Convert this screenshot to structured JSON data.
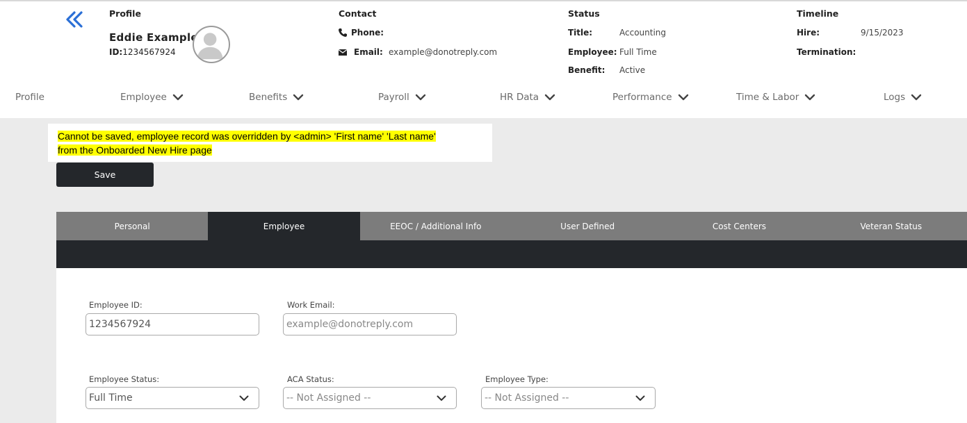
{
  "profile": {
    "heading": "Profile",
    "name": "Eddie Example",
    "id_label": "ID:",
    "id_value": "1234567924"
  },
  "contact": {
    "heading": "Contact",
    "phone_label": "Phone:",
    "phone_value": "",
    "email_label": "Email:",
    "email_value": "example@donotreply.com"
  },
  "status": {
    "heading": "Status",
    "title_label": "Title:",
    "title_value": "Accounting",
    "employee_label": "Employee:",
    "employee_value": "Full Time",
    "benefit_label": "Benefit:",
    "benefit_value": "Active"
  },
  "timeline": {
    "heading": "Timeline",
    "hire_label": "Hire:",
    "hire_value": "9/15/2023",
    "termination_label": "Termination:",
    "termination_value": ""
  },
  "nav": {
    "items": [
      {
        "label": "Profile"
      },
      {
        "label": "Employee"
      },
      {
        "label": "Benefits"
      },
      {
        "label": "Payroll"
      },
      {
        "label": "HR Data"
      },
      {
        "label": "Performance"
      },
      {
        "label": "Time & Labor"
      },
      {
        "label": "Logs"
      }
    ]
  },
  "alert": {
    "line1": "Cannot be saved, employee record was overridden by <admin> 'First name' 'Last name'",
    "line2": "from the Onboarded New Hire page"
  },
  "save_label": "Save",
  "tabs": [
    {
      "label": "Personal",
      "active": false
    },
    {
      "label": "Employee",
      "active": true
    },
    {
      "label": "EEOC / Additional Info",
      "active": false
    },
    {
      "label": "User Defined",
      "active": false
    },
    {
      "label": "Cost Centers",
      "active": false
    },
    {
      "label": "Veteran Status",
      "active": false
    }
  ],
  "form": {
    "employee_id": {
      "label": "Employee ID:",
      "value": "1234567924"
    },
    "work_email": {
      "label": "Work Email:",
      "placeholder": "example@donotreply.com"
    },
    "employee_status": {
      "label": "Employee Status:",
      "value": "Full Time"
    },
    "aca_status": {
      "label": "ACA Status:",
      "value": "-- Not Assigned --"
    },
    "employee_type": {
      "label": "Employee Type:",
      "value": "-- Not Assigned --"
    }
  },
  "colors": {
    "accent_blue": "#2a6fd6",
    "dark": "#24272b",
    "tab_gray": "#7c7c7c",
    "highlight": "#ffff00"
  },
  "icons": {
    "back": "double-chevron-left-icon",
    "avatar": "user-avatar-icon",
    "phone": "phone-icon",
    "email": "envelope-icon",
    "dropdown": "chevron-down-icon"
  }
}
